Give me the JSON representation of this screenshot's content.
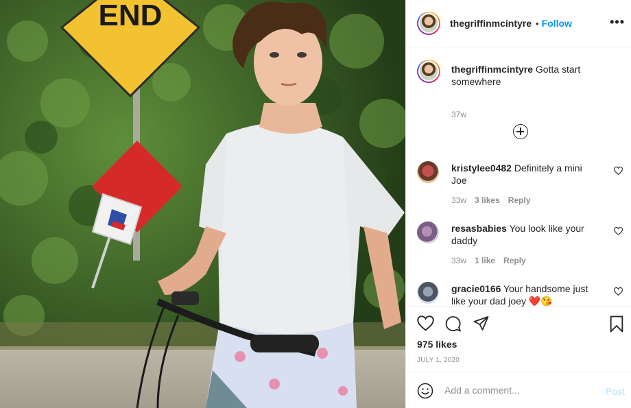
{
  "header": {
    "username": "thegriffinmcintyre",
    "separator": "•",
    "follow_label": "Follow",
    "more_label": "•••"
  },
  "caption": {
    "username": "thegriffinmcintyre",
    "text": "Gotta start somewhere",
    "time": "37w"
  },
  "comments": [
    {
      "username": "kristylee0482",
      "text": "Definitely a mini Joe",
      "time": "33w",
      "likes": "3 likes",
      "reply": "Reply"
    },
    {
      "username": "resasbabies",
      "text": "You look like your daddy",
      "time": "33w",
      "likes": "1 like",
      "reply": "Reply"
    },
    {
      "username": "gracie0166",
      "text": "Your handsome just like your dad joey ❤️😘",
      "time": "",
      "likes": "",
      "reply": ""
    }
  ],
  "photo": {
    "sign_top_text": "END"
  },
  "footer": {
    "likes": "975 likes",
    "date": "JULY 1, 2020",
    "comment_placeholder": "Add a comment...",
    "post_label": "Post"
  },
  "icons": [
    "heart-icon",
    "comment-icon",
    "share-icon",
    "bookmark-icon",
    "emoji-icon",
    "plus-circle-icon",
    "more-options-icon"
  ],
  "colors": {
    "accent": "#0095f6",
    "muted": "#8e8e8e",
    "post_disabled": "#b2dffc"
  }
}
